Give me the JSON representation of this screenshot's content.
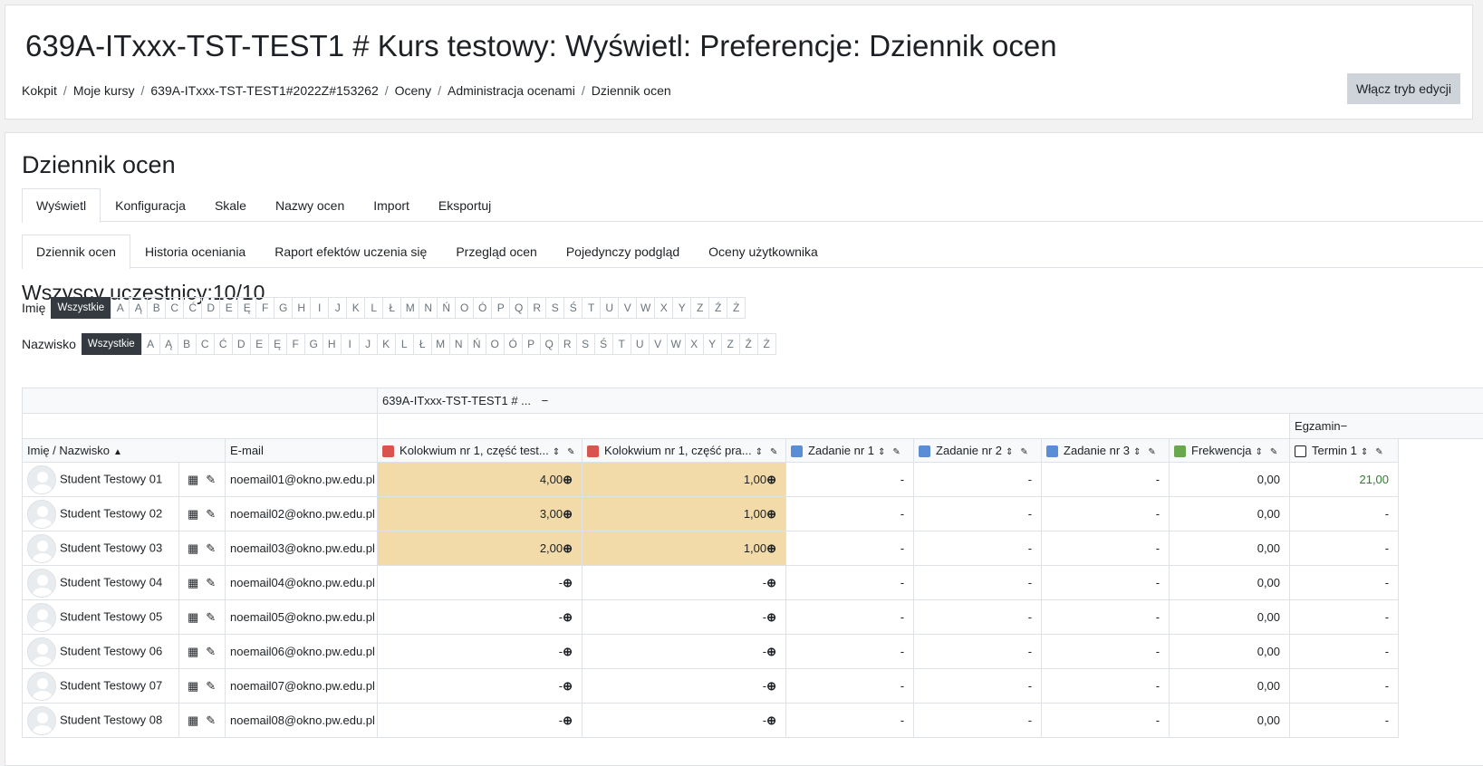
{
  "header": {
    "title": "639A-ITxxx-TST-TEST1 # Kurs testowy: Wyświetl: Preferencje: Dziennik ocen",
    "breadcrumb": [
      "Kokpit",
      "Moje kursy",
      "639A-ITxxx-TST-TEST1#2022Z#153262",
      "Oceny",
      "Administracja ocenami",
      "Dziennik ocen"
    ],
    "edit_button": "Włącz tryb edycji"
  },
  "main": {
    "title": "Dziennik ocen",
    "tabs": [
      "Wyświetl",
      "Konfiguracja",
      "Skale",
      "Nazwy ocen",
      "Import",
      "Eksportuj"
    ],
    "subtabs": [
      "Dziennik ocen",
      "Historia oceniania",
      "Raport efektów uczenia się",
      "Przegląd ocen",
      "Pojedynczy podgląd",
      "Oceny użytkownika"
    ],
    "participants": "Wszyscy uczestnicy:10/10",
    "firstname_label": "Imię",
    "lastname_label": "Nazwisko",
    "all_label": "Wszystkie",
    "letters": [
      "A",
      "Ą",
      "B",
      "C",
      "Ć",
      "D",
      "E",
      "Ę",
      "F",
      "G",
      "H",
      "I",
      "J",
      "K",
      "L",
      "Ł",
      "M",
      "N",
      "Ń",
      "O",
      "Ó",
      "P",
      "Q",
      "R",
      "S",
      "Ś",
      "T",
      "U",
      "V",
      "W",
      "X",
      "Y",
      "Z",
      "Ź",
      "Ż"
    ]
  },
  "grader": {
    "course_category": "639A-ITxxx-TST-TEST1 # ...",
    "category_collapse": "−",
    "exam_category": "Egzamin",
    "col_name": "Imię / Nazwisko",
    "col_email": "E-mail",
    "items": [
      "Kolokwium nr 1, część test...",
      "Kolokwium nr 1, część pra...",
      "Zadanie nr 1",
      "Zadanie nr 2",
      "Zadanie nr 3",
      "Frekwencja",
      "Termin 1"
    ],
    "icon_colors": [
      "#d9534f",
      "#d9534f",
      "#5b8dd6",
      "#5b8dd6",
      "#5b8dd6",
      "#6aa84f",
      "#ffffff"
    ],
    "override_color": "#f2dba8",
    "students": [
      {
        "name": "Student Testowy 01",
        "email": "noemail01@okno.pw.edu.pl",
        "g1": "4,00",
        "g2": "1,00",
        "z1": "-",
        "z2": "-",
        "z3": "-",
        "f": "0,00",
        "t1": "21,00"
      },
      {
        "name": "Student Testowy 02",
        "email": "noemail02@okno.pw.edu.pl",
        "g1": "3,00",
        "g2": "1,00",
        "z1": "-",
        "z2": "-",
        "z3": "-",
        "f": "0,00",
        "t1": "-"
      },
      {
        "name": "Student Testowy 03",
        "email": "noemail03@okno.pw.edu.pl",
        "g1": "2,00",
        "g2": "1,00",
        "z1": "-",
        "z2": "-",
        "z3": "-",
        "f": "0,00",
        "t1": "-"
      },
      {
        "name": "Student Testowy 04",
        "email": "noemail04@okno.pw.edu.pl",
        "g1": "-",
        "g2": "-",
        "z1": "-",
        "z2": "-",
        "z3": "-",
        "f": "0,00",
        "t1": "-"
      },
      {
        "name": "Student Testowy 05",
        "email": "noemail05@okno.pw.edu.pl",
        "g1": "-",
        "g2": "-",
        "z1": "-",
        "z2": "-",
        "z3": "-",
        "f": "0,00",
        "t1": "-"
      },
      {
        "name": "Student Testowy 06",
        "email": "noemail06@okno.pw.edu.pl",
        "g1": "-",
        "g2": "-",
        "z1": "-",
        "z2": "-",
        "z3": "-",
        "f": "0,00",
        "t1": "-"
      },
      {
        "name": "Student Testowy 07",
        "email": "noemail07@okno.pw.edu.pl",
        "g1": "-",
        "g2": "-",
        "z1": "-",
        "z2": "-",
        "z3": "-",
        "f": "0,00",
        "t1": "-"
      },
      {
        "name": "Student Testowy 08",
        "email": "noemail08@okno.pw.edu.pl",
        "g1": "-",
        "g2": "-",
        "z1": "-",
        "z2": "-",
        "z3": "-",
        "f": "0,00",
        "t1": "-"
      }
    ]
  }
}
